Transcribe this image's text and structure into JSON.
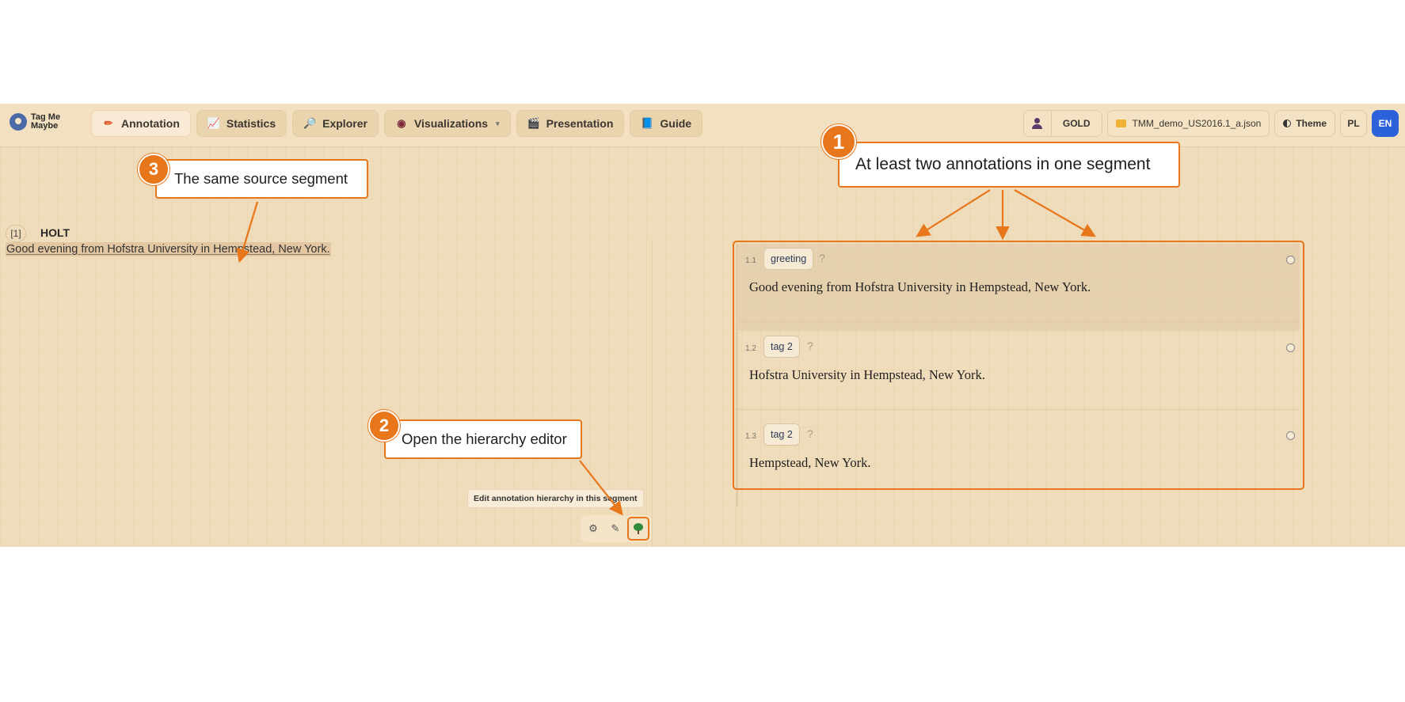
{
  "logo": {
    "line1": "Tag Me",
    "line2": "Maybe"
  },
  "nav": [
    {
      "label": "Annotation",
      "icon": "pencil-icon",
      "glyph": "✏"
    },
    {
      "label": "Statistics",
      "icon": "chart-icon",
      "glyph": "📈"
    },
    {
      "label": "Explorer",
      "icon": "magnifier-icon",
      "glyph": "🔎"
    },
    {
      "label": "Visualizations",
      "icon": "eye-icon",
      "glyph": "◉"
    },
    {
      "label": "Presentation",
      "icon": "clapper-icon",
      "glyph": "🎬"
    },
    {
      "label": "Guide",
      "icon": "book-icon",
      "glyph": "📘"
    }
  ],
  "user": {
    "name": "GOLD"
  },
  "file": {
    "name": "TMM_demo_US2016.1_a.json"
  },
  "theme": {
    "label": "Theme"
  },
  "languages": [
    "PL",
    "EN"
  ],
  "segment": {
    "number": "[1]",
    "speaker": "HOLT",
    "text": "Good evening from Hofstra University in Hempstead, New York."
  },
  "tooltip": "Edit annotation hierarchy in this segment",
  "mini_tools": {
    "settings_glyph": "⚙",
    "edit_glyph": "✎"
  },
  "annotations": [
    {
      "id": "1.1",
      "tag": "greeting",
      "help": "?",
      "text": "Good evening from Hofstra University in Hempstead, New York."
    },
    {
      "id": "1.2",
      "tag": "tag 2",
      "help": "?",
      "text": "Hofstra University in Hempstead, New York."
    },
    {
      "id": "1.3",
      "tag": "tag 2",
      "help": "?",
      "text": "Hempstead, New York."
    }
  ],
  "callouts": [
    {
      "number": "1",
      "text": "At least two annotations in one segment"
    },
    {
      "number": "2",
      "text": "Open the hierarchy editor"
    },
    {
      "number": "3",
      "text": "The same source segment"
    }
  ],
  "colors": {
    "accent": "#e8761a",
    "background": "#efdcbb",
    "language_active": "#2b62d9"
  }
}
